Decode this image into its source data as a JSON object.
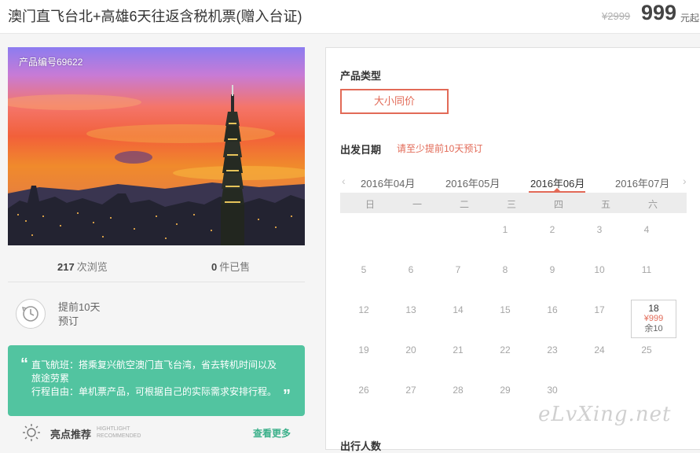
{
  "header": {
    "title": "澳门直飞台北+高雄6天往返含税机票(赠入台证)",
    "original_price": "¥2999",
    "price": "999",
    "price_suffix": "元起"
  },
  "product": {
    "id_label": "产品编号69622",
    "views_count": "217",
    "views_label": "次浏览",
    "sold_count": "0",
    "sold_label": "件已售"
  },
  "booking": {
    "line1": "提前10天",
    "line2": "预订",
    "icon": "clock-icon"
  },
  "intro": {
    "line1": "直飞航班：搭乘复兴航空澳门直飞台湾，省去转机时间以及",
    "line2": "旅途劳累",
    "line3": "行程自由：单机票产品，可根据自己的实际需求安排行程。"
  },
  "highlights": {
    "title": "亮点推荐",
    "en_line1": "HIGHTLIGHT",
    "en_line2": "RECOMMENDED",
    "more": "查看更多",
    "icon": "sun-icon"
  },
  "panel": {
    "type_title": "产品类型",
    "type_option": "大小同价",
    "date_title": "出发日期",
    "date_notice": "请至少提前10天预订",
    "people_title": "出行人数"
  },
  "calendar": {
    "prev_arrow": "‹",
    "next_arrow": "›",
    "months": [
      "2016年04月",
      "2016年05月",
      "2016年06月",
      "2016年07月"
    ],
    "active_month": "2016年06月",
    "weekdays": [
      "日",
      "一",
      "二",
      "三",
      "四",
      "五",
      "六"
    ],
    "weeks": [
      [
        "",
        "",
        "",
        "1",
        "2",
        "3",
        "4"
      ],
      [
        "5",
        "6",
        "7",
        "8",
        "9",
        "10",
        "11"
      ],
      [
        "12",
        "13",
        "14",
        "15",
        "16",
        "17",
        "18"
      ],
      [
        "19",
        "20",
        "21",
        "22",
        "23",
        "24",
        "25"
      ],
      [
        "26",
        "27",
        "28",
        "29",
        "30",
        "",
        ""
      ]
    ],
    "selected": {
      "day": "18",
      "price": "¥999",
      "remaining": "余10"
    }
  },
  "watermark": "eLvXing.net",
  "colors": {
    "accent": "#e26a57",
    "green": "#52c4a0",
    "link_green": "#3bb08a"
  }
}
